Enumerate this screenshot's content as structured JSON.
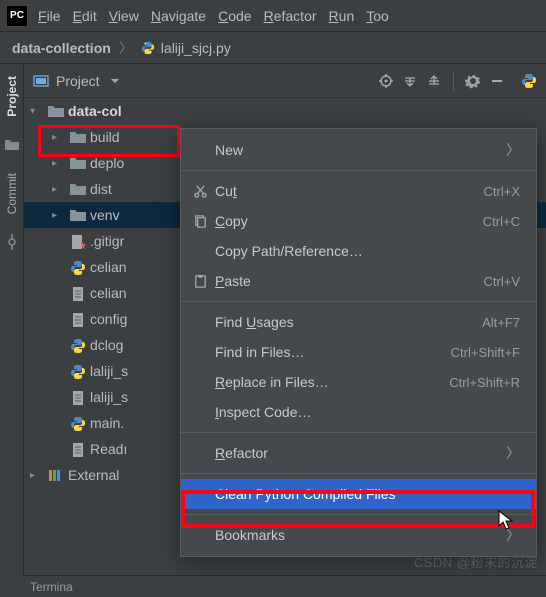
{
  "menubar": {
    "items": [
      "File",
      "Edit",
      "View",
      "Navigate",
      "Code",
      "Refactor",
      "Run",
      "Too"
    ]
  },
  "breadcrumb": {
    "project": "data-collection",
    "file": "laliji_sjcj.py"
  },
  "gutter": {
    "project": "Project",
    "commit": "Commit"
  },
  "project_panel": {
    "title": "Project"
  },
  "tree": {
    "root": "data-col",
    "items": [
      {
        "name": "build",
        "type": "folder",
        "arr": ">"
      },
      {
        "name": "deplo",
        "type": "folder",
        "arr": ">"
      },
      {
        "name": "dist",
        "type": "folder",
        "arr": ">"
      },
      {
        "name": "venv",
        "type": "folder",
        "arr": ">",
        "sel": true
      },
      {
        "name": ".gitigr",
        "type": "file",
        "icon": "git"
      },
      {
        "name": "celian",
        "type": "file",
        "icon": "py"
      },
      {
        "name": "celian",
        "type": "file",
        "icon": "txt"
      },
      {
        "name": "config",
        "type": "file",
        "icon": "txt"
      },
      {
        "name": "dclog",
        "type": "file",
        "icon": "py"
      },
      {
        "name": "laliji_s",
        "type": "file",
        "icon": "py"
      },
      {
        "name": "laliji_s",
        "type": "file",
        "icon": "txt"
      },
      {
        "name": "main.",
        "type": "file",
        "icon": "py"
      },
      {
        "name": "Readı",
        "type": "file",
        "icon": "txt"
      }
    ],
    "external": "External"
  },
  "context_menu": {
    "items": [
      {
        "label": "New",
        "icon": "",
        "shortcut": "",
        "sub": true
      },
      {
        "sep": true
      },
      {
        "label": "Cut",
        "icon": "cut",
        "shortcut": "Ctrl+X",
        "u": 2
      },
      {
        "label": "Copy",
        "icon": "copy",
        "shortcut": "Ctrl+C",
        "u": 0
      },
      {
        "label": "Copy Path/Reference…",
        "icon": "",
        "shortcut": ""
      },
      {
        "label": "Paste",
        "icon": "paste",
        "shortcut": "Ctrl+V",
        "u": 0
      },
      {
        "sep": true
      },
      {
        "label": "Find Usages",
        "icon": "",
        "shortcut": "Alt+F7",
        "u": 5
      },
      {
        "label": "Find in Files…",
        "icon": "",
        "shortcut": "Ctrl+Shift+F"
      },
      {
        "label": "Replace in Files…",
        "icon": "",
        "shortcut": "Ctrl+Shift+R",
        "u": 0
      },
      {
        "label": "Inspect Code…",
        "icon": "",
        "shortcut": "",
        "u": 0
      },
      {
        "sep": true
      },
      {
        "label": "Refactor",
        "icon": "",
        "shortcut": "",
        "sub": true,
        "u": 0
      },
      {
        "sep": true
      },
      {
        "label": "Clean Python Compiled Files",
        "icon": "",
        "shortcut": "",
        "hi": true
      },
      {
        "sep": true
      },
      {
        "label": "Bookmarks",
        "icon": "",
        "shortcut": "",
        "sub": true
      }
    ]
  },
  "statusbar": {
    "terminal": "Termina"
  },
  "watermark": "CSDN @粉末的沉淀"
}
